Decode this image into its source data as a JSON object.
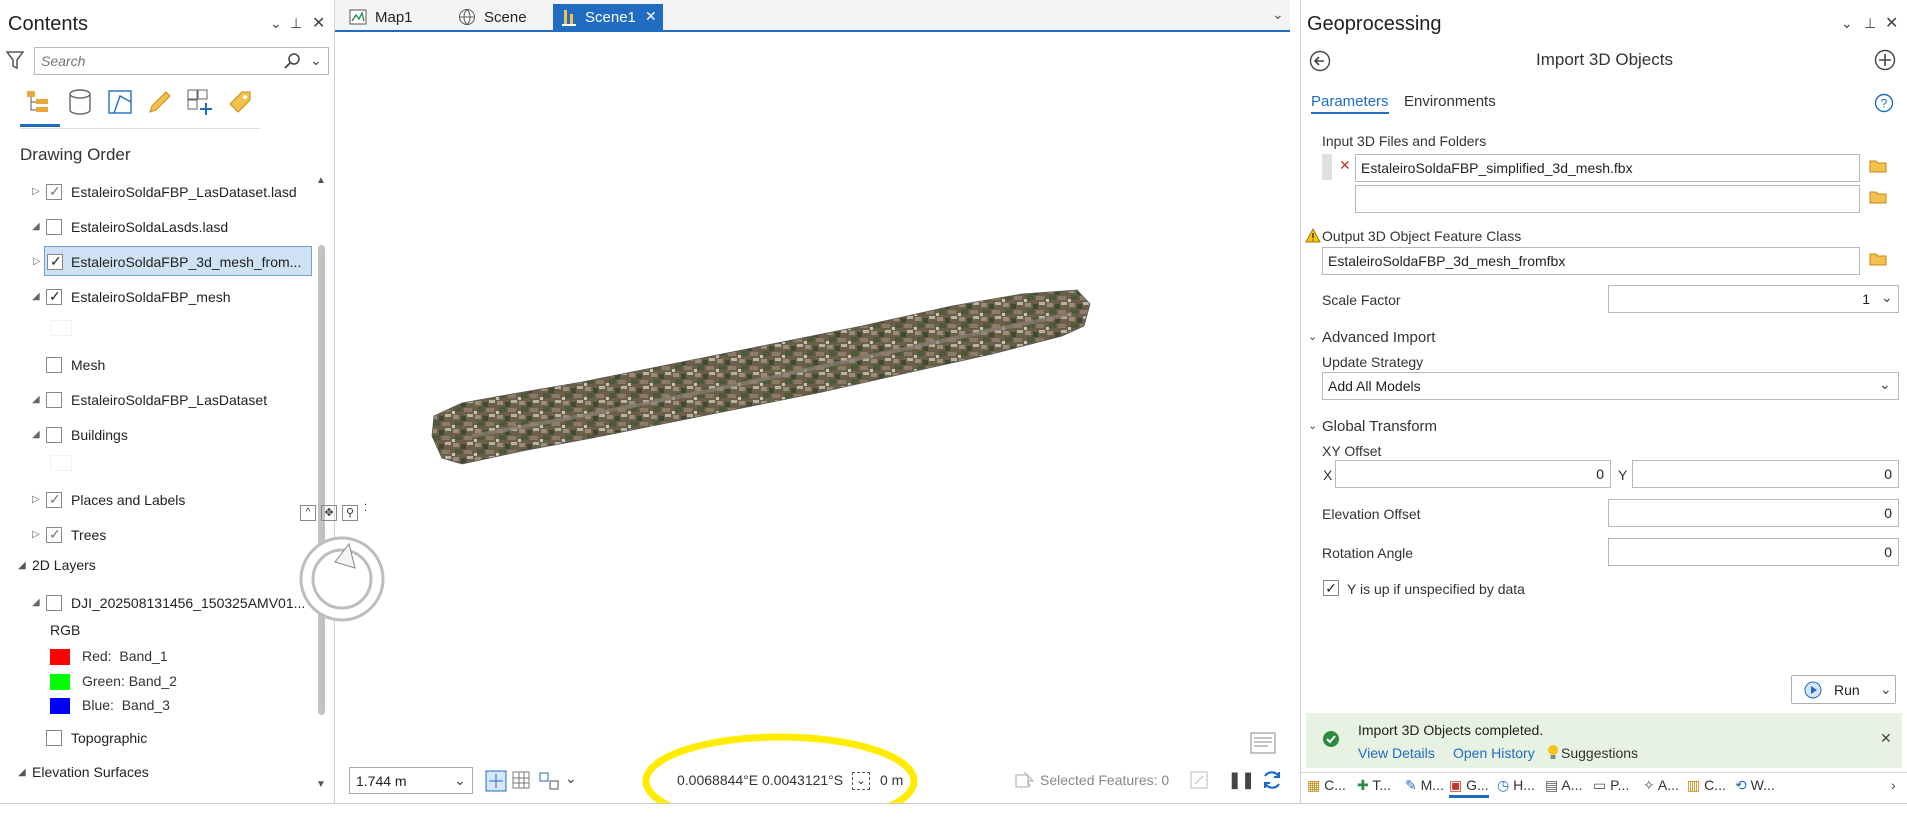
{
  "contents": {
    "title": "Contents",
    "search_placeholder": "Search",
    "drawing_order": "Drawing Order",
    "layers": [
      {
        "name": "EstaleiroSoldaFBP_LasDataset.lasd",
        "checked": true
      },
      {
        "name": "EstaleiroSoldaLasds.lasd",
        "checked": false
      },
      {
        "name": "EstaleiroSoldaFBP_3d_mesh_from...",
        "checked": true
      },
      {
        "name": "EstaleiroSoldaFBP_mesh",
        "checked": true
      },
      {
        "name": "Mesh",
        "checked": false
      },
      {
        "name": "EstaleiroSoldaFBP_LasDataset",
        "checked": false
      },
      {
        "name": "Buildings",
        "checked": false
      },
      {
        "name": "Places and Labels",
        "checked": true
      },
      {
        "name": "Trees",
        "checked": true
      }
    ],
    "group_2d": "2D Layers",
    "raster_layer": "DJI_202508131456_150325AMV01...",
    "rgb_label": "RGB",
    "bands": [
      {
        "label": "Red:",
        "band": "Band_1",
        "color": "#ff0000"
      },
      {
        "label": "Green:",
        "band": "Band_2",
        "color": "#00ff00"
      },
      {
        "label": "Blue:",
        "band": "Band_3",
        "color": "#0000ff"
      }
    ],
    "topographic": "Topographic",
    "elevation_surfaces": "Elevation Surfaces"
  },
  "tabs": [
    {
      "label": "Map1"
    },
    {
      "label": "Scene"
    },
    {
      "label": "Scene1"
    }
  ],
  "map": {
    "scale": "1.744 m",
    "coordinates": "0.0068844°E 0.0043121°S",
    "elevation": "0 m",
    "selected_features": "Selected Features: 0"
  },
  "geoprocessing": {
    "title": "Geoprocessing",
    "tool_title": "Import 3D Objects",
    "tab_parameters": "Parameters",
    "tab_environments": "Environments",
    "input_label": "Input 3D Files and Folders",
    "input_value": "EstaleiroSoldaFBP_simplified_3d_mesh.fbx",
    "output_label": "Output 3D Object Feature Class",
    "output_value": "EstaleiroSoldaFBP_3d_mesh_fromfbx",
    "scale_label": "Scale Factor",
    "scale_value": "1",
    "advanced_import": "Advanced Import",
    "update_strategy_label": "Update Strategy",
    "update_strategy_value": "Add All Models",
    "global_transform": "Global Transform",
    "xy_offset_label": "XY Offset",
    "x_label": "X",
    "x_value": "0",
    "y_label": "Y",
    "y_value": "0",
    "elev_offset_label": "Elevation Offset",
    "elev_offset_value": "0",
    "rotation_label": "Rotation Angle",
    "rotation_value": "0",
    "y_up_label": "Y is up if unspecified by data",
    "run_label": "Run",
    "success_msg": "Import 3D Objects completed.",
    "view_details": "View Details",
    "open_history": "Open History",
    "suggestions": "Suggestions",
    "bottom_tabs": [
      "C...",
      "T...",
      "M...",
      "G...",
      "H...",
      "A...",
      "P...",
      "A...",
      "C...",
      "W..."
    ]
  },
  "colors": {
    "accent": "#1f6cc1",
    "highlight": "#ffec00",
    "success_bg": "#e8f2e2"
  }
}
